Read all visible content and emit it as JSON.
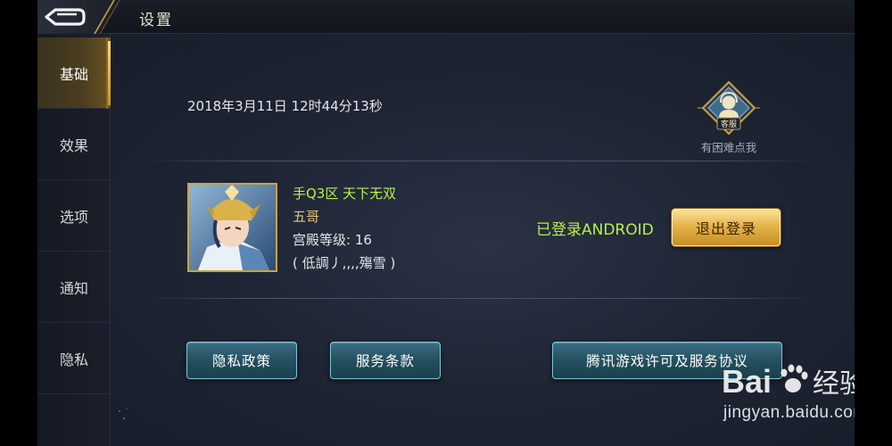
{
  "header": {
    "title": "设置",
    "back_icon": "back-arrow-icon"
  },
  "sidebar": {
    "items": [
      {
        "label": "基础",
        "active": true
      },
      {
        "label": "效果",
        "active": false
      },
      {
        "label": "选项",
        "active": false
      },
      {
        "label": "通知",
        "active": false
      },
      {
        "label": "隐私",
        "active": false
      }
    ]
  },
  "main": {
    "datetime": "2018年3月11日 12时44分13秒",
    "support": {
      "badge_label": "客服",
      "hint": "有困难点我",
      "icon": "customer-service-icon"
    },
    "account": {
      "server": "手Q3区 天下无双",
      "nickname": "五哥",
      "palace_level": "宫殿等级: 16",
      "tag": "( 低調丿,,,,殤雪 )",
      "login_status": "已登录ANDROID",
      "logout_label": "退出登录"
    },
    "buttons": {
      "privacy_policy": "隐私政策",
      "terms": "服务条款",
      "license": "腾讯游戏许可及服务协议"
    }
  },
  "watermark": {
    "logo_text": "Bai经验",
    "url": "jingyan.baidu.com"
  },
  "colors": {
    "accent_gold": "#e5b44a",
    "status_green": "#b7ee4e",
    "nickname_gold": "#dfc477",
    "button_blue": "#24505f"
  }
}
